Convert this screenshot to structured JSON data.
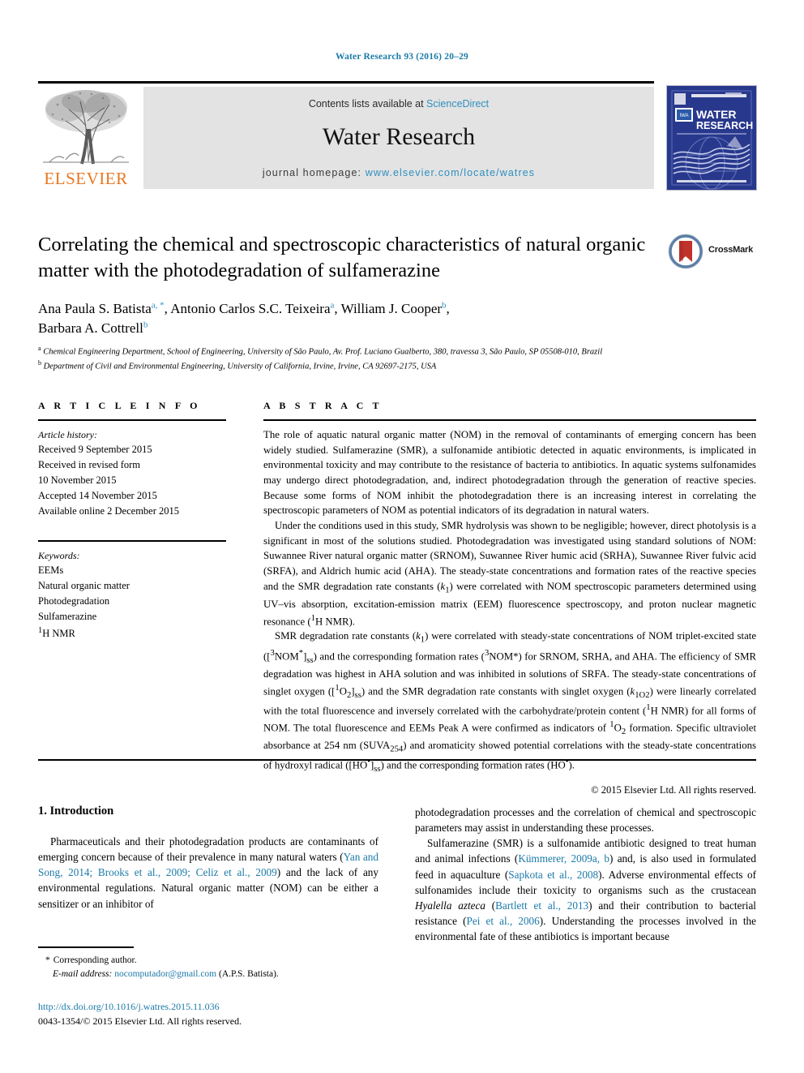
{
  "running_head": "Water Research 93 (2016) 20–29",
  "banner": {
    "contents_prefix": "Contents lists available at ",
    "sciencedirect": "ScienceDirect",
    "journal_title": "Water Research",
    "homepage_prefix": "journal homepage: ",
    "homepage_url": "www.elsevier.com/locate/watres",
    "publisher_logo_text": "ELSEVIER",
    "cover_title_line1": "WATER",
    "cover_title_line2": "RESEARCH",
    "cover_badge": "IWA",
    "link_color": "#2e8fc0",
    "logo_color": "#e87722",
    "cover_bg": "#28388c"
  },
  "crossmark": {
    "label": "CrossMark"
  },
  "article": {
    "title": "Correlating the chemical and spectroscopic characteristics of natural organic matter with the photodegradation of sulfamerazine",
    "authors_line1_pre": "Ana Paula S. Batista",
    "authors_line1_mid": ", Antonio Carlos S.C. Teixeira",
    "authors_line1_post": ", William J. Cooper",
    "authors_line2": "Barbara A. Cottrell",
    "mark_a": "a",
    "mark_a_star": "a, *",
    "mark_b": "b",
    "affiliation_a": "Chemical Engineering Department, School of Engineering, University of São Paulo, Av. Prof. Luciano Gualberto, 380, travessa 3, São Paulo, SP 05508-010, Brazil",
    "affiliation_b": "Department of Civil and Environmental Engineering, University of California, Irvine, Irvine, CA 92697-2175, USA"
  },
  "article_info": {
    "heading": "A R T I C L E   I N F O",
    "history_label": "Article history:",
    "history": [
      "Received 9 September 2015",
      "Received in revised form",
      "10 November 2015",
      "Accepted 14 November 2015",
      "Available online 2 December 2015"
    ],
    "keywords_label": "Keywords:",
    "keywords": [
      "EEMs",
      "Natural organic matter",
      "Photodegradation",
      "Sulfamerazine",
      "1H NMR"
    ]
  },
  "abstract": {
    "heading": "A B S T R A C T",
    "paragraph1": "The role of aquatic natural organic matter (NOM) in the removal of contaminants of emerging concern has been widely studied. Sulfamerazine (SMR), a sulfonamide antibiotic detected in aquatic environments, is implicated in environmental toxicity and may contribute to the resistance of bacteria to antibiotics. In aquatic systems sulfonamides may undergo direct photodegradation, and, indirect photodegradation through the generation of reactive species. Because some forms of NOM inhibit the photodegradation there is an increasing interest in correlating the spectroscopic parameters of NOM as potential indicators of its degradation in natural waters.",
    "paragraph2": "Under the conditions used in this study, SMR hydrolysis was shown to be negligible; however, direct photolysis is a significant in most of the solutions studied. Photodegradation was investigated using standard solutions of NOM: Suwannee River natural organic matter (SRNOM), Suwannee River humic acid (SRHA), Suwannee River fulvic acid (SRFA), and Aldrich humic acid (AHA). The steady-state concentrations and formation rates of the reactive species and the SMR degradation rate constants (k1) were correlated with NOM spectroscopic parameters determined using UV–vis absorption, excitation-emission matrix (EEM) fluorescence spectroscopy, and proton nuclear magnetic resonance (1H NMR).",
    "paragraph3": "SMR degradation rate constants (k1) were correlated with steady-state concentrations of NOM triplet-excited state ([3NOM*]ss) and the corresponding formation rates (3NOM*) for SRNOM, SRHA, and AHA. The efficiency of SMR degradation was highest in AHA solution and was inhibited in solutions of SRFA. The steady-state concentrations of singlet oxygen ([1O2]ss) and the SMR degradation rate constants with singlet oxygen (k1O2) were linearly correlated with the total fluorescence and inversely correlated with the carbohydrate/protein content (1H NMR) for all forms of NOM. The total fluorescence and EEMs Peak A were confirmed as indicators of 1O2 formation. Specific ultraviolet absorbance at 254 nm (SUVA254) and aromaticity showed potential correlations with the steady-state concentrations of hydroxyl radical ([HO•]ss) and the corresponding formation rates (HO•).",
    "copyright": "© 2015 Elsevier Ltd. All rights reserved."
  },
  "introduction": {
    "heading": "1. Introduction",
    "left_paragraph": "Pharmaceuticals and their photodegradation products are contaminants of emerging concern because of their prevalence in many natural waters (Yan and Song, 2014; Brooks et al., 2009; Celiz et al., 2009) and the lack of any environmental regulations. Natural organic matter (NOM) can be either a sensitizer or an inhibitor of",
    "right_paragraph1": "photodegradation processes and the correlation of chemical and spectroscopic parameters may assist in understanding these processes.",
    "right_paragraph2": "Sulfamerazine (SMR) is a sulfonamide antibiotic designed to treat human and animal infections (Kümmerer, 2009a, b) and, is also used in formulated feed in aquaculture (Sapkota et al., 2008). Adverse environmental effects of sulfonamides include their toxicity to organisms such as the crustacean Hyalella azteca (Bartlett et al., 2013) and their contribution to bacterial resistance (Pei et al., 2006). Understanding the processes involved in the environmental fate of these antibiotics is important because"
  },
  "footer": {
    "corresponding_star": "*",
    "corresponding_label": "Corresponding author.",
    "email_label": "E-mail address:",
    "email": "nocomputador@gmail.com",
    "email_suffix": "(A.P.S. Batista).",
    "doi": "http://dx.doi.org/10.1016/j.watres.2015.11.036",
    "issn_line": "0043-1354/© 2015 Elsevier Ltd. All rights reserved."
  }
}
